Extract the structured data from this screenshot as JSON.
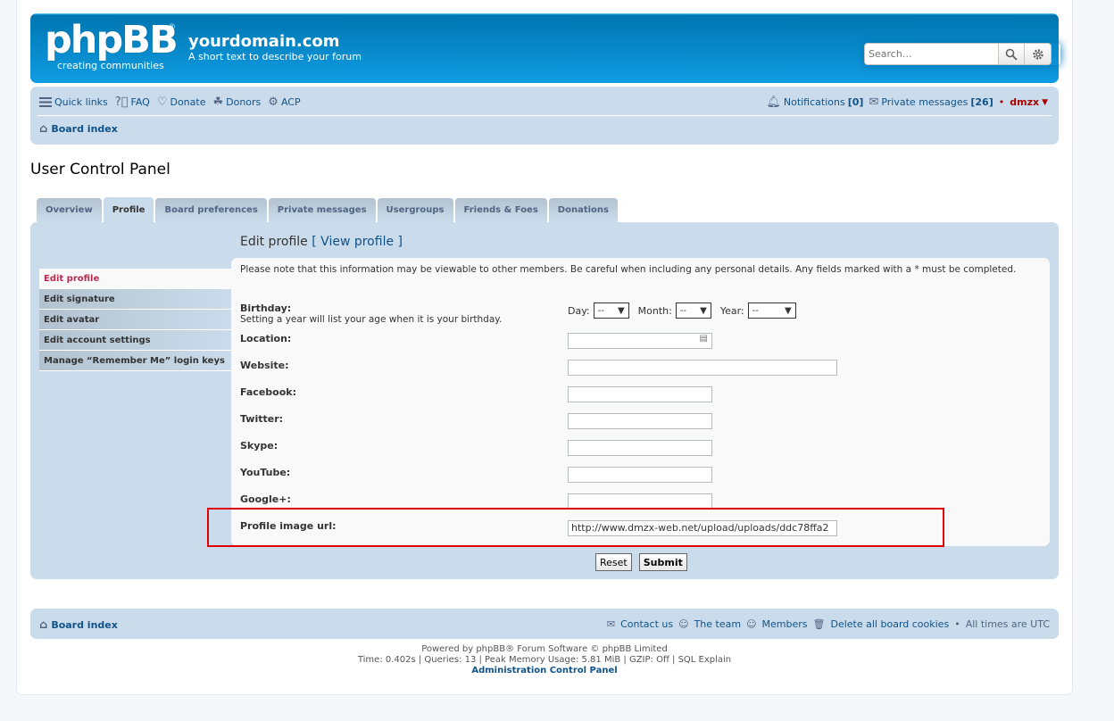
{
  "header": {
    "logo_text": "phpBB",
    "logo_registered": "®",
    "logo_tagline": "creating communities",
    "site_title": "yourdomain.com",
    "site_description": "A short text to describe your forum",
    "search_placeholder": "Search…"
  },
  "navbar": {
    "quick_links": "Quick links",
    "faq": "FAQ",
    "donate": "Donate",
    "donors": "Donors",
    "acp": "ACP",
    "notifications": "Notifications",
    "notifications_count": "[0]",
    "private_messages": "Private messages",
    "pm_count": "[26]",
    "bullet": "•",
    "username": "dmzx",
    "breadcrumb": "Board index"
  },
  "page_title": "User Control Panel",
  "tabs": [
    "Overview",
    "Profile",
    "Board preferences",
    "Private messages",
    "Usergroups",
    "Friends & Foes",
    "Donations"
  ],
  "sidebar": [
    "Edit profile",
    "Edit signature",
    "Edit avatar",
    "Edit account settings",
    "Manage “Remember Me” login keys"
  ],
  "edit_profile": {
    "heading": "Edit profile",
    "bracket_open": "[",
    "view_profile": "View profile",
    "bracket_close": "]",
    "notice": "Please note that this information may be viewable to other members. Be careful when including any personal details. Any fields marked with a * must be completed.",
    "birthday_label": "Birthday:",
    "birthday_help": "Setting a year will list your age when it is your birthday.",
    "day_label": "Day:",
    "month_label": "Month:",
    "year_label": "Year:",
    "day_value": "--",
    "month_value": "--",
    "year_value": "--",
    "location_label": "Location:",
    "website_label": "Website:",
    "facebook_label": "Facebook:",
    "twitter_label": "Twitter:",
    "skype_label": "Skype:",
    "youtube_label": "YouTube:",
    "googleplus_label": "Google+:",
    "profile_image_label": "Profile image url:",
    "profile_image_value": "http://www.dmzx-web.net/upload/uploads/ddc78ffa2"
  },
  "buttons": {
    "reset": "Reset",
    "submit": "Submit"
  },
  "footer": {
    "breadcrumb": "Board index",
    "contact": "Contact us",
    "team": "The team",
    "members": "Members",
    "delete_cookies": "Delete all board cookies",
    "bullet": "•",
    "times": "All times are UTC",
    "powered": "Powered by phpBB® Forum Software © phpBB Limited",
    "debug": "Time: 0.402s | Queries: 13 | Peak Memory Usage: 5.81 MiB | GZIP: Off | SQL Explain",
    "acp_link": "Administration Control Panel"
  }
}
